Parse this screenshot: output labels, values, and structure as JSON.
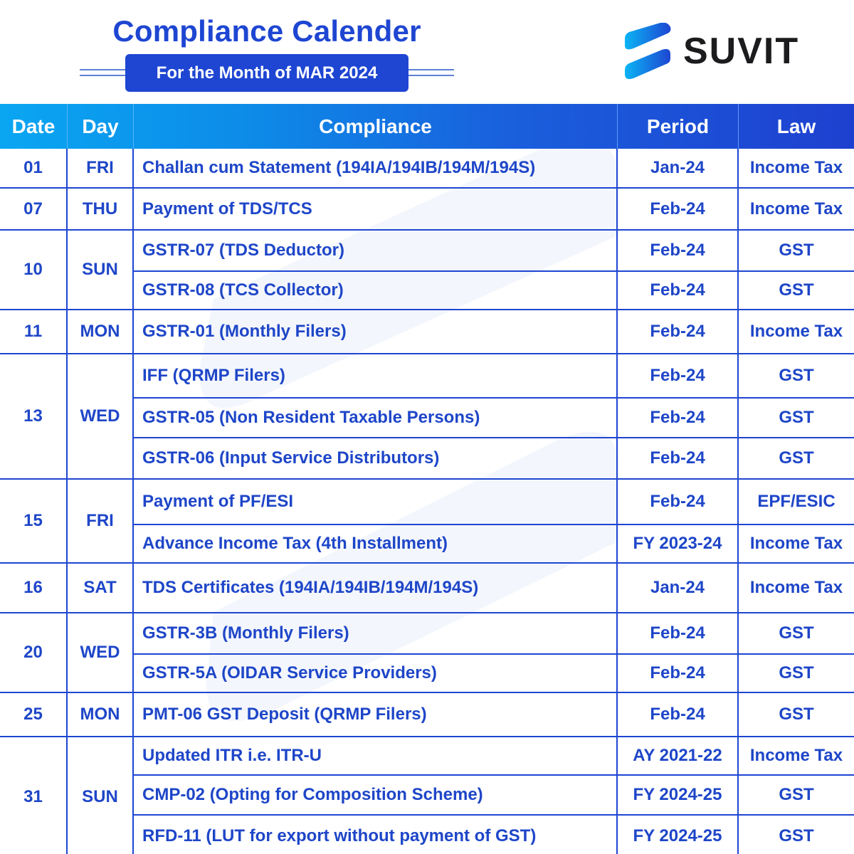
{
  "header": {
    "title": "Compliance Calender",
    "subtitle": "For the Month of MAR 2024"
  },
  "brand": {
    "name": "SUVIT",
    "logo_icon": "suvit-s-logo-icon",
    "colors": {
      "primary": "#1e46d2",
      "gradient_start": "#0aa6f2",
      "gradient_end": "#1e40d0",
      "text_dark": "#1c1c1e"
    }
  },
  "table": {
    "columns": [
      "Date",
      "Day",
      "Compliance",
      "Period",
      "Law"
    ],
    "groups": [
      {
        "date": "01",
        "day": "FRI",
        "items": [
          {
            "compliance": "Challan cum Statement (194IA/194IB/194M/194S)",
            "period": "Jan-24",
            "law": "Income Tax"
          }
        ]
      },
      {
        "date": "07",
        "day": "THU",
        "items": [
          {
            "compliance": "Payment of TDS/TCS",
            "period": "Feb-24",
            "law": "Income Tax"
          }
        ]
      },
      {
        "date": "10",
        "day": "SUN",
        "items": [
          {
            "compliance": "GSTR-07 (TDS Deductor)",
            "period": "Feb-24",
            "law": "GST"
          },
          {
            "compliance": "GSTR-08 (TCS Collector)",
            "period": "Feb-24",
            "law": "GST"
          }
        ]
      },
      {
        "date": "11",
        "day": "MON",
        "items": [
          {
            "compliance": "GSTR-01 (Monthly Filers)",
            "period": "Feb-24",
            "law": "Income Tax"
          }
        ]
      },
      {
        "date": "13",
        "day": "WED",
        "items": [
          {
            "compliance": "IFF (QRMP Filers)",
            "period": "Feb-24",
            "law": "GST"
          },
          {
            "compliance": "GSTR-05 (Non Resident Taxable Persons)",
            "period": "Feb-24",
            "law": "GST"
          },
          {
            "compliance": "GSTR-06 (Input Service Distributors)",
            "period": "Feb-24",
            "law": "GST"
          }
        ]
      },
      {
        "date": "15",
        "day": "FRI",
        "items": [
          {
            "compliance": "Payment of PF/ESI",
            "period": "Feb-24",
            "law": "EPF/ESIC"
          },
          {
            "compliance": "Advance Income Tax (4th Installment)",
            "period": "FY 2023-24",
            "law": "Income Tax"
          }
        ]
      },
      {
        "date": "16",
        "day": "SAT",
        "items": [
          {
            "compliance": "TDS Certificates (194IA/194IB/194M/194S)",
            "period": "Jan-24",
            "law": "Income Tax"
          }
        ]
      },
      {
        "date": "20",
        "day": "WED",
        "items": [
          {
            "compliance": "GSTR-3B (Monthly Filers)",
            "period": "Feb-24",
            "law": "GST"
          },
          {
            "compliance": "GSTR-5A (OIDAR Service Providers)",
            "period": "Feb-24",
            "law": "GST"
          }
        ]
      },
      {
        "date": "25",
        "day": "MON",
        "items": [
          {
            "compliance": "PMT-06 GST Deposit (QRMP Filers)",
            "period": "Feb-24",
            "law": "GST"
          }
        ]
      },
      {
        "date": "31",
        "day": "SUN",
        "items": [
          {
            "compliance": "Updated ITR i.e. ITR-U",
            "period": "AY 2021-22",
            "law": "Income Tax"
          },
          {
            "compliance": "CMP-02 (Opting for Composition Scheme)",
            "period": "FY 2024-25",
            "law": "GST"
          },
          {
            "compliance": "RFD-11 (LUT for export without payment of GST)",
            "period": "FY 2024-25",
            "law": "GST"
          }
        ]
      }
    ]
  }
}
